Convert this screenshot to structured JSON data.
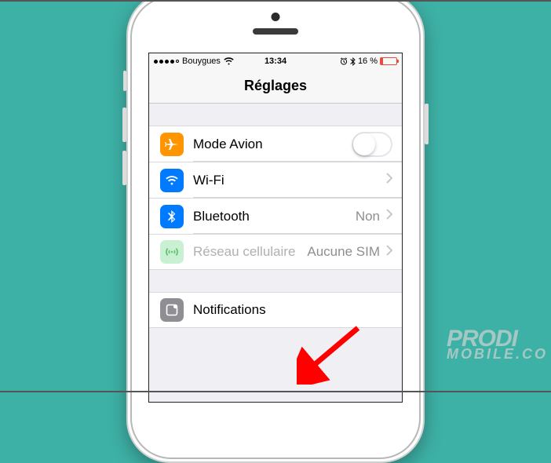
{
  "statusbar": {
    "carrier": "Bouygues",
    "time": "13:34",
    "battery_text": "16 %"
  },
  "navbar": {
    "title": "Réglages"
  },
  "rows": {
    "airplane": {
      "label": "Mode Avion"
    },
    "wifi": {
      "label": "Wi-Fi",
      "value": ""
    },
    "bluetooth": {
      "label": "Bluetooth",
      "value": "Non"
    },
    "cellular": {
      "label": "Réseau cellulaire",
      "value": "Aucune SIM"
    },
    "notifications": {
      "label": "Notifications"
    }
  },
  "icons": {
    "airplane": {
      "bg": "#ff9500"
    },
    "wifi": {
      "bg": "#007aff"
    },
    "bluetooth": {
      "bg": "#007aff"
    },
    "cellular": {
      "bg": "#4cd964",
      "disabled": true
    },
    "notifications": {
      "bg": "#8e8e93"
    }
  },
  "watermark": {
    "line1": "PRODI",
    "line2": "MOBILE.CO"
  }
}
